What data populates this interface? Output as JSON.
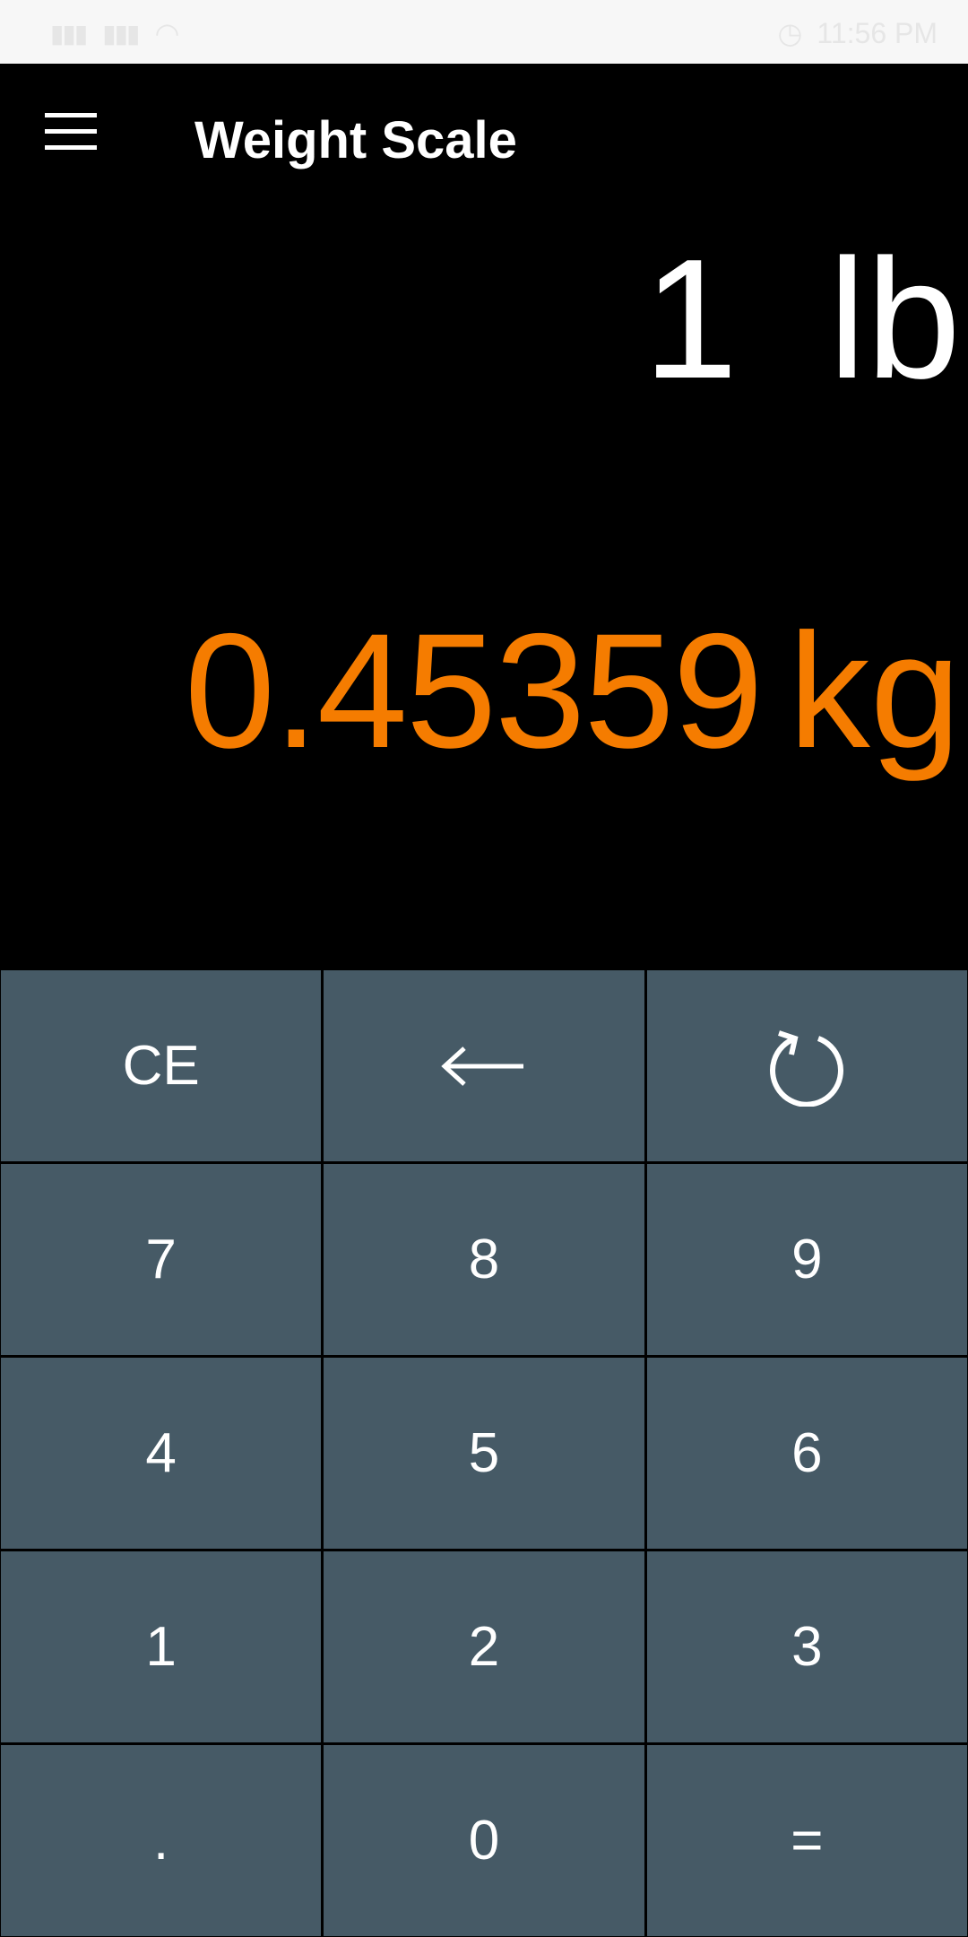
{
  "status_bar": {
    "left_icons": [
      "signal-icon",
      "signal-icon",
      "wifi-icon"
    ],
    "time": "11:56 PM"
  },
  "app_bar": {
    "title": "Weight Scale",
    "menu_icon": "menu-icon"
  },
  "display": {
    "input_value": "1",
    "input_unit": "lb",
    "result_value": "0.45359",
    "result_unit": "kg",
    "result_color": "#f57c00"
  },
  "keypad": {
    "key_color": "#465a66",
    "rows": [
      [
        "CE",
        "backspace",
        "swap"
      ],
      [
        "7",
        "8",
        "9"
      ],
      [
        "4",
        "5",
        "6"
      ],
      [
        "1",
        "2",
        "3"
      ],
      [
        ".",
        "0",
        "="
      ]
    ],
    "labels": {
      "ce": "CE",
      "seven": "7",
      "eight": "8",
      "nine": "9",
      "four": "4",
      "five": "5",
      "six": "6",
      "one": "1",
      "two": "2",
      "three": "3",
      "dot": ".",
      "zero": "0",
      "equals": "="
    },
    "icons": {
      "backspace": "arrow-left-icon",
      "swap": "refresh-icon"
    }
  }
}
